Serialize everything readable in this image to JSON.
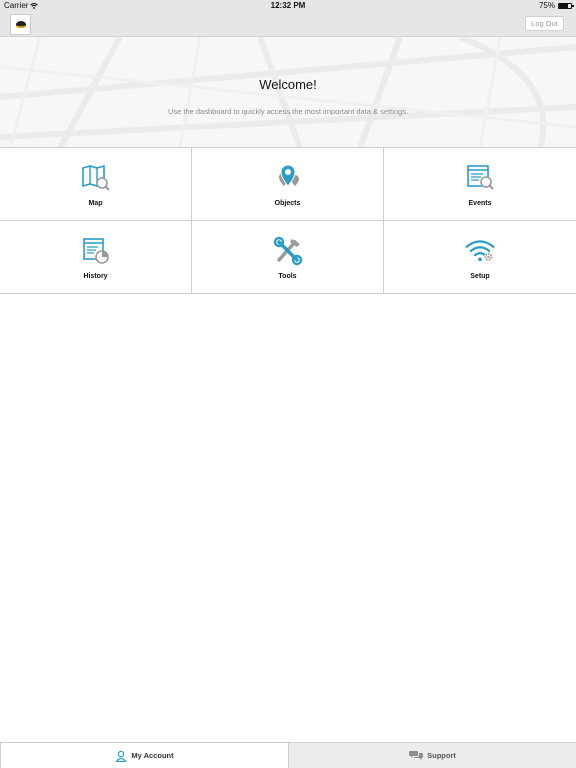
{
  "status_bar": {
    "carrier": "Carrier",
    "time": "12:32 PM",
    "battery": "75%",
    "battery_level": 0.75
  },
  "nav": {
    "logout_label": "Log Out",
    "logo_icon": "company-logo"
  },
  "hero": {
    "title": "Welcome!",
    "subtitle": "Use the dashboard to quickly access the most important data & settings."
  },
  "tiles": [
    {
      "label": "Map",
      "icon": "map-icon"
    },
    {
      "label": "Objects",
      "icon": "objects-icon"
    },
    {
      "label": "Events",
      "icon": "events-icon"
    },
    {
      "label": "History",
      "icon": "history-icon"
    },
    {
      "label": "Tools",
      "icon": "tools-icon"
    },
    {
      "label": "Setup",
      "icon": "setup-icon"
    }
  ],
  "tabs": {
    "account_label": "My Account",
    "support_label": "Support"
  },
  "colors": {
    "accent": "#2a9cc6",
    "icon_gray": "#9a9a9a",
    "bar": "#e6e6e6"
  }
}
